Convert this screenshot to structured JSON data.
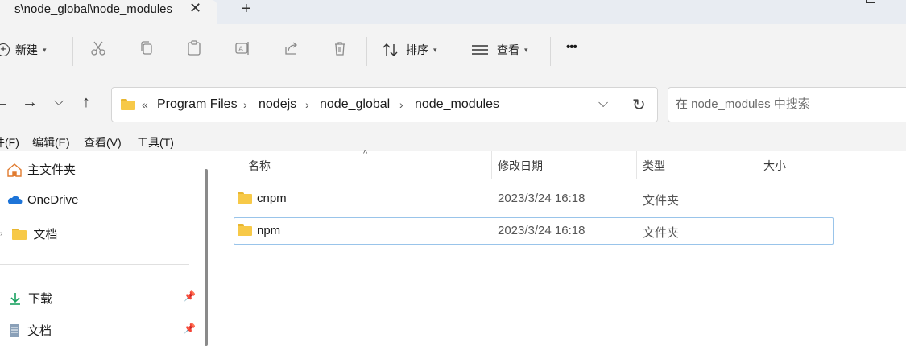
{
  "tab": {
    "title": "s\\node_global\\node_modules",
    "close": "✕",
    "new": "+"
  },
  "toolbar": {
    "new_label": "新建",
    "sort_label": "排序",
    "view_label": "查看",
    "more": "•••"
  },
  "address": {
    "overflow": "«",
    "crumbs": [
      "Program Files",
      "nodejs",
      "node_global",
      "node_modules"
    ],
    "sep": "›"
  },
  "search": {
    "placeholder": "在 node_modules 中搜索"
  },
  "menu": [
    "件(F)",
    "编辑(E)",
    "查看(V)",
    "工具(T)"
  ],
  "nav": {
    "home": "主文件夹",
    "onedrive": "OneDrive",
    "docs_folder": "文档",
    "downloads": "下载",
    "documents": "文档"
  },
  "columns": {
    "name": "名称",
    "modified": "修改日期",
    "type": "类型",
    "size": "大小"
  },
  "files": [
    {
      "name": "cnpm",
      "modified": "2023/3/24 16:18",
      "type": "文件夹",
      "size": ""
    },
    {
      "name": "npm",
      "modified": "2023/3/24 16:18",
      "type": "文件夹",
      "size": ""
    }
  ],
  "selected_index": 1
}
